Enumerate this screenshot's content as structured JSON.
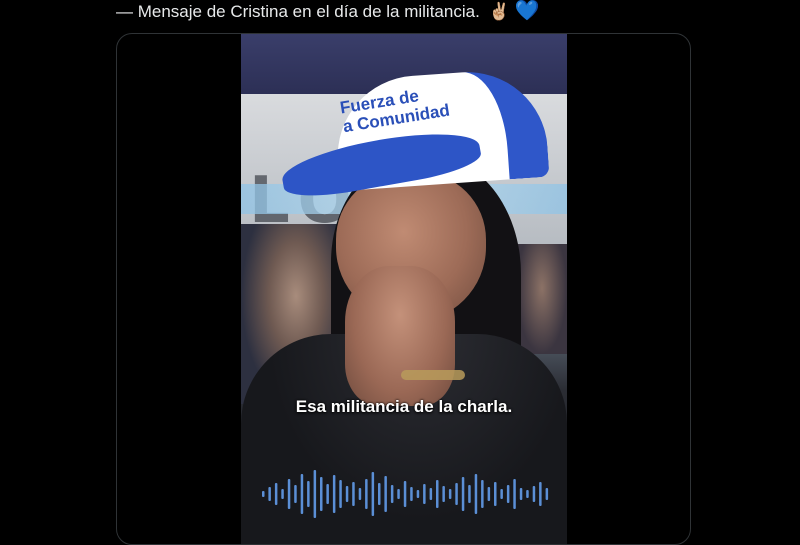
{
  "tweet": {
    "text": "— Mensaje de Cristina en el día de la militancia.",
    "emoji_victory": "✌🏼",
    "emoji_heart": "💙"
  },
  "video": {
    "cap_line1": "Fuerza de",
    "cap_line2": "a Comunidad",
    "banner_text": "LOS",
    "subtitle": "Esa militancia de la charla.",
    "waveform_color": "#5b8fd6"
  },
  "colors": {
    "background": "#000000",
    "card_border": "#2f3336",
    "text": "#e7e9ea",
    "cap_blue": "#2d55c6"
  }
}
